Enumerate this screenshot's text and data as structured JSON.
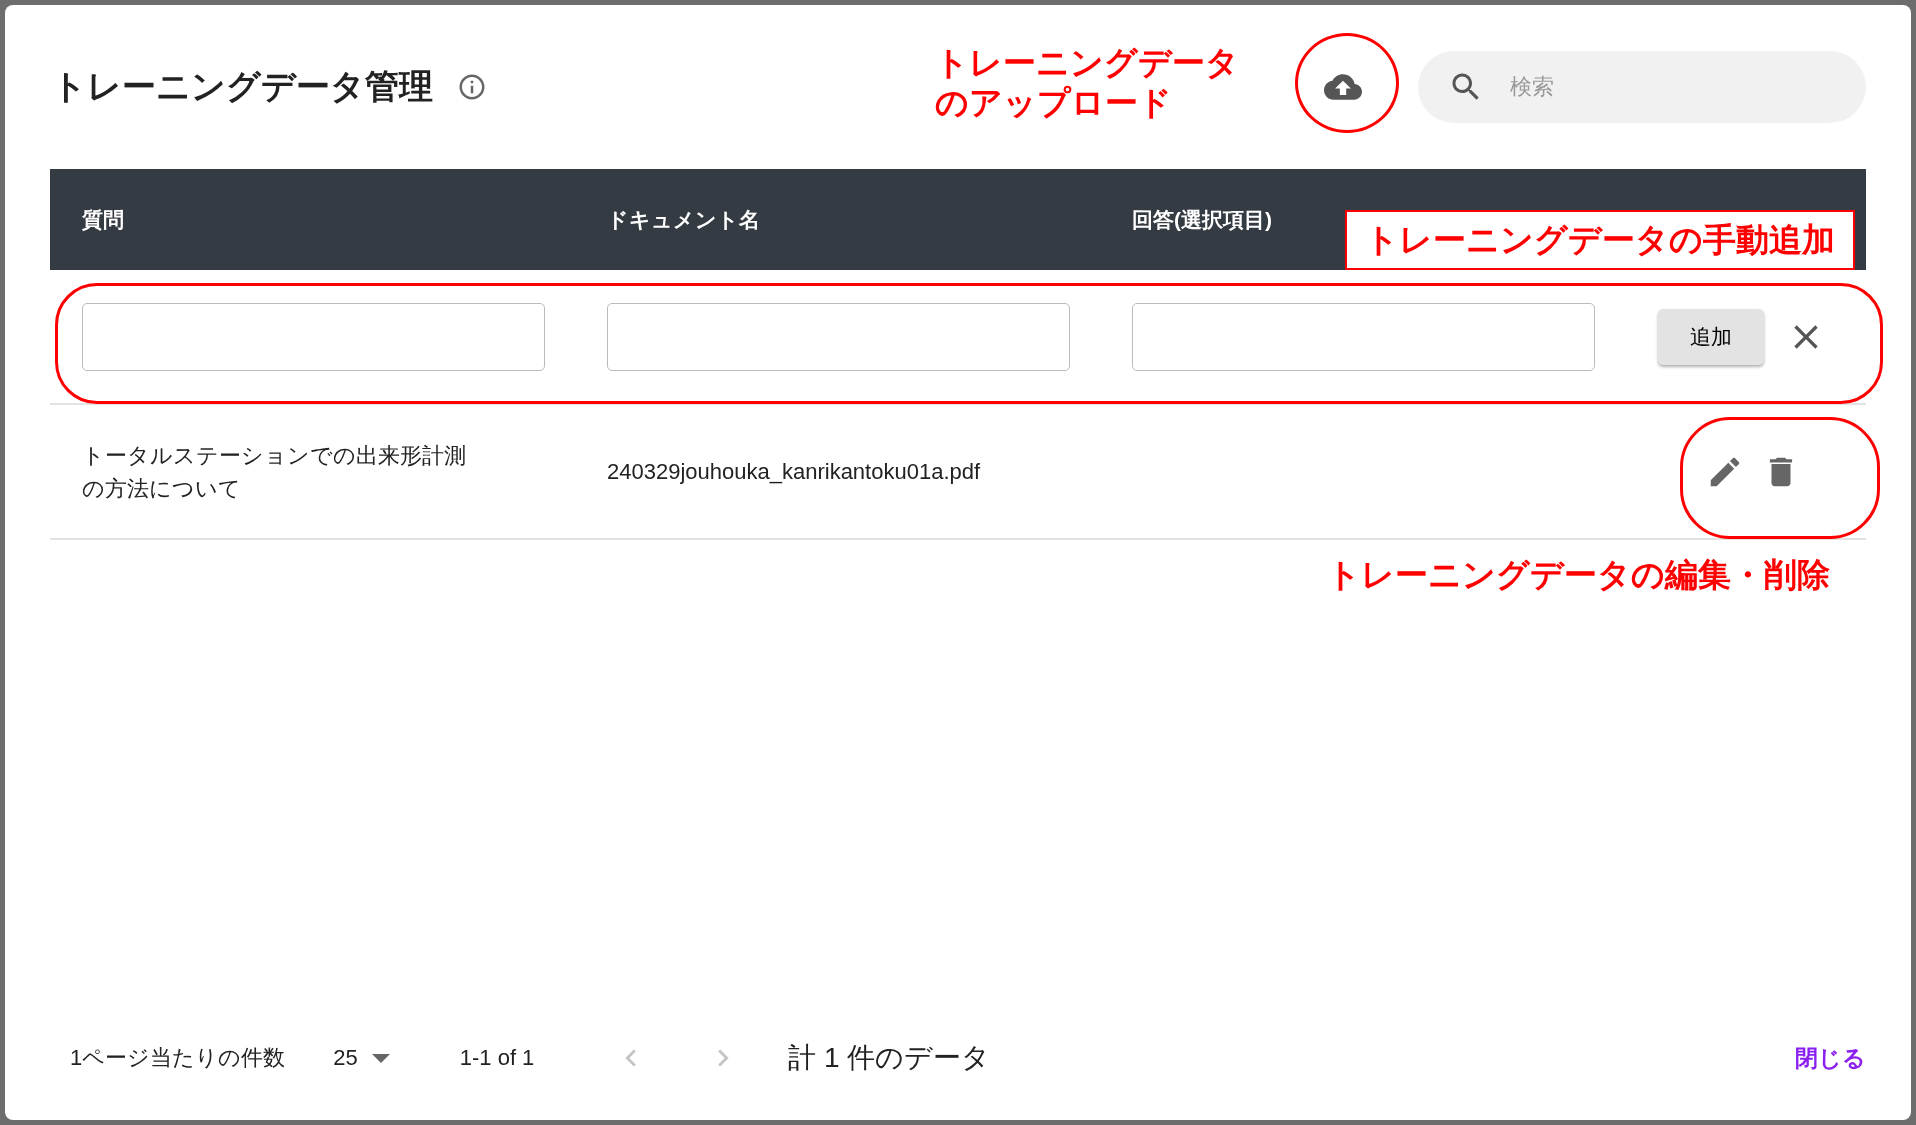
{
  "dialog": {
    "title": "トレーニングデータ管理",
    "search": {
      "placeholder": "検索"
    }
  },
  "table": {
    "columns": [
      "質問",
      "ドキュメント名",
      "回答(選択項目)"
    ],
    "new_row": {
      "add_button": "追加"
    },
    "rows": [
      {
        "question": "トータルステーションでの出来形計測の方法について",
        "document": "240329jouhouka_kanrikantoku01a.pdf"
      }
    ]
  },
  "footer": {
    "rows_per_page_label": "1ページ当たりの件数",
    "rows_per_page": "25",
    "range": "1-1 of 1",
    "prev_disabled": true,
    "next_disabled": true,
    "total": "計 1 件のデータ",
    "close_button": "閉じる"
  },
  "annotations": [
    {
      "kind": "upload",
      "lines": [
        "トレーニングデータ",
        "のアップロード"
      ]
    },
    {
      "kind": "manual_add",
      "lines": [
        "トレーニングデータの手動追加"
      ]
    },
    {
      "kind": "edit_delete",
      "lines": [
        "トレーニングデータの編集・削除"
      ]
    }
  ]
}
